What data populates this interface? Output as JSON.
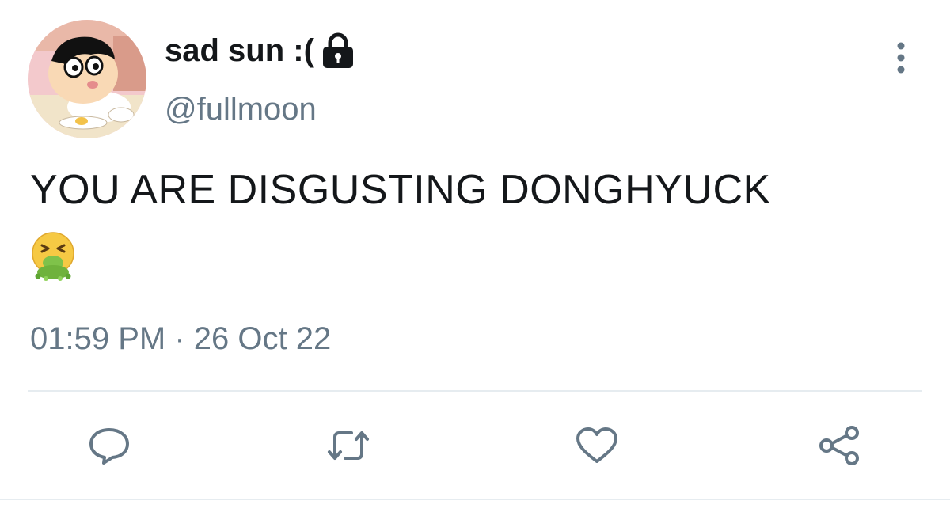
{
  "tweet": {
    "display_name": "sad sun :(",
    "handle": "@fullmoon",
    "text": "YOU ARE DISGUSTING DONGHYUCK",
    "emoji": "🤮",
    "timestamp": "01:59 PM · 26 Oct 22",
    "protected": true
  },
  "icons": {
    "lock": "lock-icon",
    "more": "more-vertical-icon",
    "reply": "reply-icon",
    "retweet": "retweet-icon",
    "like": "heart-icon",
    "share": "share-icon"
  },
  "colors": {
    "text": "#14171a",
    "muted": "#657786",
    "divider": "#e6ecf0"
  }
}
